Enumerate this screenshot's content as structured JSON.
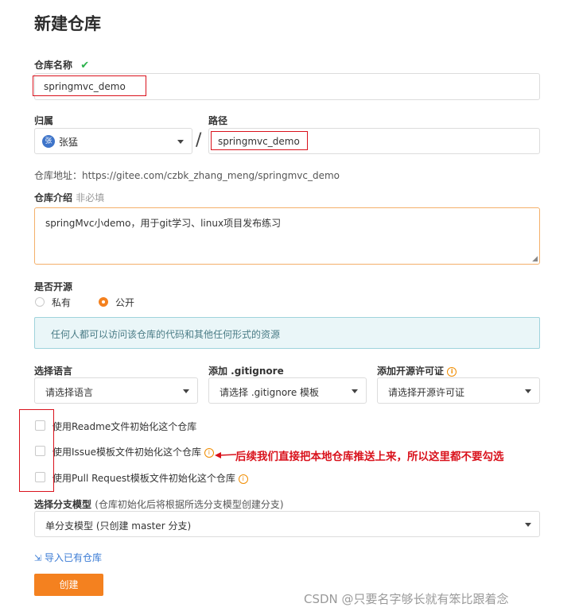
{
  "page": {
    "title": "新建仓库"
  },
  "repo_name": {
    "label": "仓库名称",
    "value": "springmvc_demo"
  },
  "owner": {
    "label": "归属",
    "avatar_text": "张",
    "value": "张猛"
  },
  "path": {
    "label": "路径",
    "separator": "/",
    "value": "springmvc_demo"
  },
  "repo_url": {
    "text": "仓库地址：https://gitee.com/czbk_zhang_meng/springmvc_demo"
  },
  "description": {
    "label": "仓库介绍",
    "optional": "非必填",
    "value": "springMvc小demo，用于git学习、linux项目发布练习"
  },
  "visibility": {
    "label": "是否开源",
    "options": [
      {
        "label": "私有",
        "selected": false
      },
      {
        "label": "公开",
        "selected": true
      }
    ],
    "notice": "任何人都可以访问该仓库的代码和其他任何形式的资源"
  },
  "language": {
    "label": "选择语言",
    "placeholder": "请选择语言"
  },
  "gitignore": {
    "label": "添加 .gitignore",
    "placeholder": "请选择 .gitignore 模板"
  },
  "license": {
    "label": "添加开源许可证",
    "placeholder": "请选择开源许可证"
  },
  "init_options": [
    {
      "label": "使用Readme文件初始化这个仓库",
      "checked": false
    },
    {
      "label": "使用Issue模板文件初始化这个仓库",
      "checked": false
    },
    {
      "label": "使用Pull Request模板文件初始化这个仓库",
      "checked": false
    }
  ],
  "annotation": {
    "text": "后续我们直接把本地仓库推送上来，所以这里都不要勾选"
  },
  "branch_model": {
    "label": "选择分支模型",
    "hint": "(仓库初始化后将根据所选分支模型创建分支)",
    "value": "单分支模型 (只创建 master 分支)"
  },
  "import_link": {
    "label": "导入已有仓库"
  },
  "create_button": {
    "label": "创建"
  },
  "watermark": {
    "text": "CSDN @只要名字够长就有笨比跟着念"
  },
  "colors": {
    "accent": "#f4811f",
    "success": "#2bb24c",
    "annotation_red": "#d9121c",
    "notice_bg": "#eaf6f8",
    "notice_border": "#9fd3dc",
    "link": "#3a7bd5"
  },
  "icons": {
    "name_check": "check-icon",
    "info": "info-icon",
    "import": "import-icon",
    "caret": "chevron-down-icon"
  }
}
